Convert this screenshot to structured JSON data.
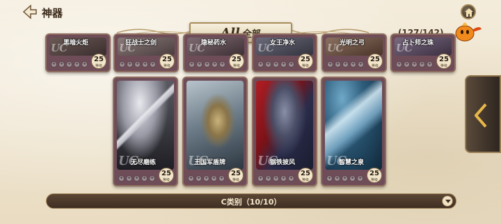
{
  "header": {
    "title": "神器",
    "back_icon": "back-arrow-icon",
    "home_icon": "home-icon"
  },
  "filter": {
    "latin": "All",
    "cn": "全部"
  },
  "collection_count": "(127/142)",
  "top_row": [
    {
      "name": "黑暗火炬",
      "rarity": "UC",
      "level": "25",
      "level_unit": "等级"
    },
    {
      "name": "狂战士之剑",
      "rarity": "UC",
      "level": "25",
      "level_unit": "等级"
    },
    {
      "name": "隐秘药水",
      "rarity": "UC",
      "level": "25",
      "level_unit": "等级"
    },
    {
      "name": "女王净水",
      "rarity": "UC",
      "level": "25",
      "level_unit": "等级"
    },
    {
      "name": "光明之弓",
      "rarity": "UC",
      "level": "25",
      "level_unit": "等级"
    },
    {
      "name": "占卜师之珠",
      "rarity": "UC",
      "level": "25",
      "level_unit": "等级"
    }
  ],
  "main_row": [
    {
      "name": "无尽磨练",
      "rarity": "UC",
      "level": "25",
      "level_unit": "等级"
    },
    {
      "name": "王国军盾牌",
      "rarity": "UC",
      "level": "25",
      "level_unit": "等级"
    },
    {
      "name": "钢铁披风",
      "rarity": "UC",
      "level": "25",
      "level_unit": "等级"
    },
    {
      "name": "智慧之泉",
      "rarity": "UC",
      "level": "25",
      "level_unit": "等级"
    }
  ],
  "category": {
    "label": "C类别（10/10）",
    "expand_icon": "chevron-down-icon"
  },
  "colors": {
    "card_frame": "#6f4d58",
    "accent_gold": "#a88d5a",
    "bar_dark": "#3e2e22"
  }
}
